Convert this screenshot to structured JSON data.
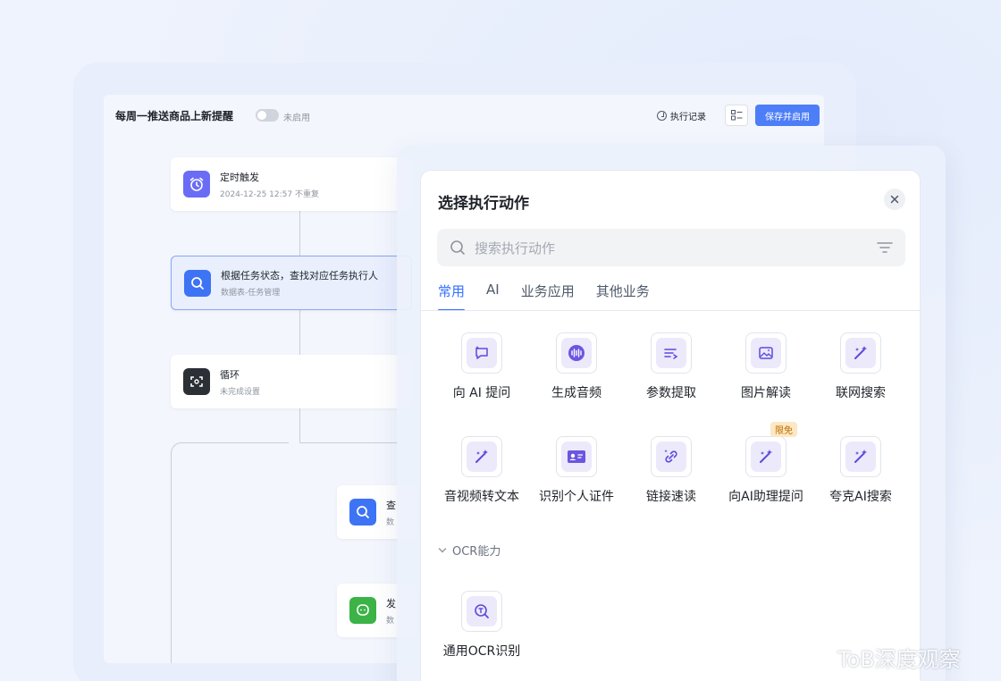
{
  "workflow": {
    "title": "每周一推送商品上新提醒",
    "toggle_label": "未启用",
    "exec_log_label": "执行记录",
    "save_label": "保存并启用"
  },
  "nodes": [
    {
      "title": "定时触发",
      "subtitle": "2024-12-25 12:57 不重复",
      "icon": "alarm-clock-icon",
      "color": "#6b6cf6"
    },
    {
      "title": "根据任务状态，查找对应任务执行人",
      "subtitle": "数据表-任务管理",
      "icon": "search-icon",
      "color": "#3d73f5"
    },
    {
      "title": "循环",
      "subtitle": "未完成设置",
      "icon": "loop-icon",
      "color": "#2b2f36"
    },
    {
      "title": "查",
      "subtitle": "数",
      "icon": "search-icon",
      "color": "#3d73f5"
    },
    {
      "title": "发",
      "subtitle": "数",
      "icon": "chat-icon",
      "color": "#3bb346"
    }
  ],
  "dialog": {
    "title": "选择执行动作",
    "search_placeholder": "搜索执行动作",
    "tabs": [
      "常用",
      "AI",
      "业务应用",
      "其他业务"
    ],
    "actions": [
      {
        "label": "向 AI 提问",
        "icon": "ai-chat-icon"
      },
      {
        "label": "生成音频",
        "icon": "audio-wave-icon"
      },
      {
        "label": "参数提取",
        "icon": "extract-list-icon"
      },
      {
        "label": "图片解读",
        "icon": "image-spark-icon"
      },
      {
        "label": "联网搜索",
        "icon": "magic-wand-icon"
      },
      {
        "label": "音视频转文本",
        "icon": "magic-wand-icon"
      },
      {
        "label": "识别个人证件",
        "icon": "id-card-icon"
      },
      {
        "label": "链接速读",
        "icon": "link-spark-icon"
      },
      {
        "label": "向AI助理提问",
        "icon": "magic-wand-icon",
        "badge": "限免"
      },
      {
        "label": "夸克AI搜索",
        "icon": "magic-wand-icon"
      }
    ],
    "section_title": "OCR能力",
    "ocr_actions": [
      {
        "label": "通用OCR识别",
        "icon": "ocr-scan-icon"
      }
    ]
  },
  "watermark": "ToB深度观察",
  "colors": {
    "accent": "#3370ff",
    "icon_bg": "#ece9fb",
    "icon_fg": "#5b4bdb"
  }
}
